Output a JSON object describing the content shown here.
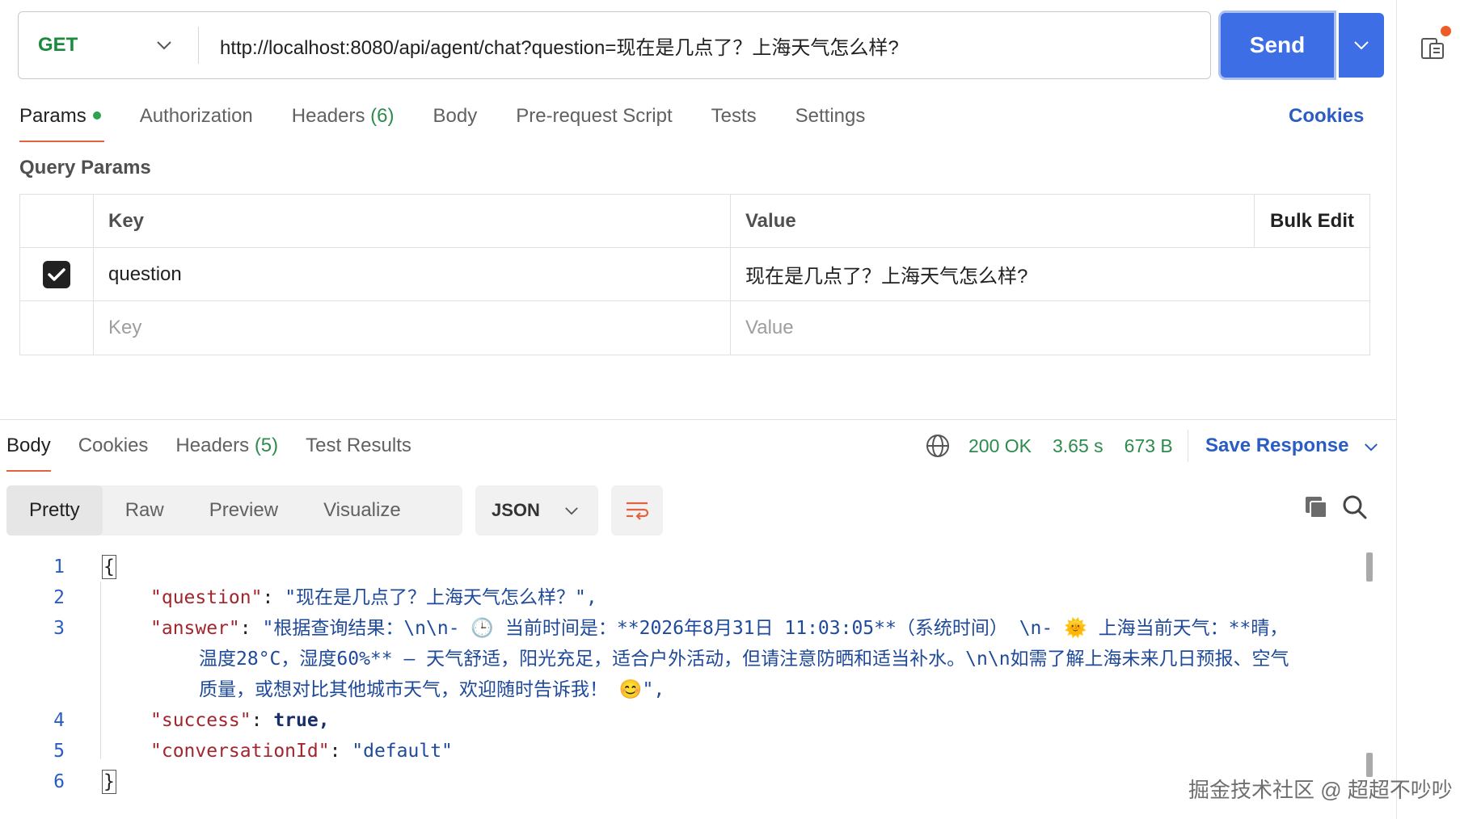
{
  "request": {
    "method": "GET",
    "url": "http://localhost:8080/api/agent/chat?question=现在是几点了？上海天气怎么样?",
    "send_label": "Send"
  },
  "request_tabs": [
    {
      "label": "Params",
      "active": true,
      "dot": true
    },
    {
      "label": "Authorization"
    },
    {
      "label": "Headers",
      "count": "(6)"
    },
    {
      "label": "Body"
    },
    {
      "label": "Pre-request Script"
    },
    {
      "label": "Tests"
    },
    {
      "label": "Settings"
    }
  ],
  "cookies_link": "Cookies",
  "query_params": {
    "title": "Query Params",
    "headers": {
      "key": "Key",
      "value": "Value",
      "bulk": "Bulk Edit"
    },
    "rows": [
      {
        "checked": true,
        "key": "question",
        "value": "现在是几点了？上海天气怎么样?"
      }
    ],
    "placeholder": {
      "key": "Key",
      "value": "Value"
    }
  },
  "response": {
    "tabs": [
      {
        "label": "Body",
        "active": true
      },
      {
        "label": "Cookies"
      },
      {
        "label": "Headers",
        "count": "(5)"
      },
      {
        "label": "Test Results"
      }
    ],
    "status": "200 OK",
    "time": "3.65 s",
    "size": "673 B",
    "save_label": "Save Response",
    "view_modes": [
      "Pretty",
      "Raw",
      "Preview",
      "Visualize"
    ],
    "format": "JSON",
    "code_lines": [
      {
        "n": "1",
        "text": "{"
      },
      {
        "n": "2",
        "key": "\"question\"",
        "value": "\"现在是几点了？上海天气怎么样？\","
      },
      {
        "n": "3",
        "key": "\"answer\"",
        "value": "\"根据查询结果：\\n\\n- 🕒 当前时间是：**2026年8月31日 11:03:05**（系统时间） \\n- 🌞 上海当前天气：**晴，",
        "cont": [
          "温度28°C，湿度60%** — 天气舒适，阳光充足，适合户外活动，但请注意防晒和适当补水。\\n\\n如需了解上海未来几日预报、空气",
          "质量，或想对比其他城市天气，欢迎随时告诉我！ 😊\","
        ]
      },
      {
        "n": "4",
        "key": "\"success\"",
        "bool": "true,"
      },
      {
        "n": "5",
        "key": "\"conversationId\"",
        "value": "\"default\""
      },
      {
        "n": "6",
        "text": "}"
      }
    ]
  },
  "watermark": "掘金技术社区 @ 超超不吵吵",
  "colors": {
    "accent": "#3e6ee6",
    "method": "#1c8a3c",
    "tab_underline": "#e2643e",
    "status": "#2e8b4e",
    "link": "#2a5dc4"
  }
}
